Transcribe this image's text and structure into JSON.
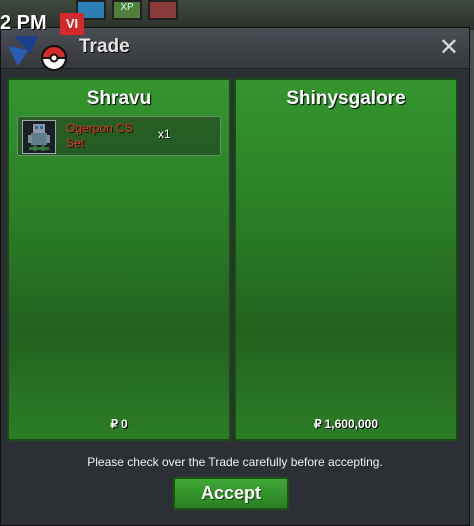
{
  "background": {
    "tile_label": "XP"
  },
  "overlay": {
    "clock": "2 PM",
    "badge": "VI"
  },
  "window": {
    "title": "Trade"
  },
  "left_panel": {
    "player": "Shravu",
    "item": {
      "name": "Ogerpon CS Set",
      "qty": "x1"
    },
    "money": "0"
  },
  "right_panel": {
    "player": "Shinysgalore",
    "money": "1,600,000"
  },
  "footer": {
    "notice": "Please check over the Trade carefully before accepting.",
    "accept_label": "Accept"
  },
  "colors": {
    "panel_green": "#2a7d26",
    "item_name_red": "#e0321e",
    "accept_green": "#3fa835"
  }
}
